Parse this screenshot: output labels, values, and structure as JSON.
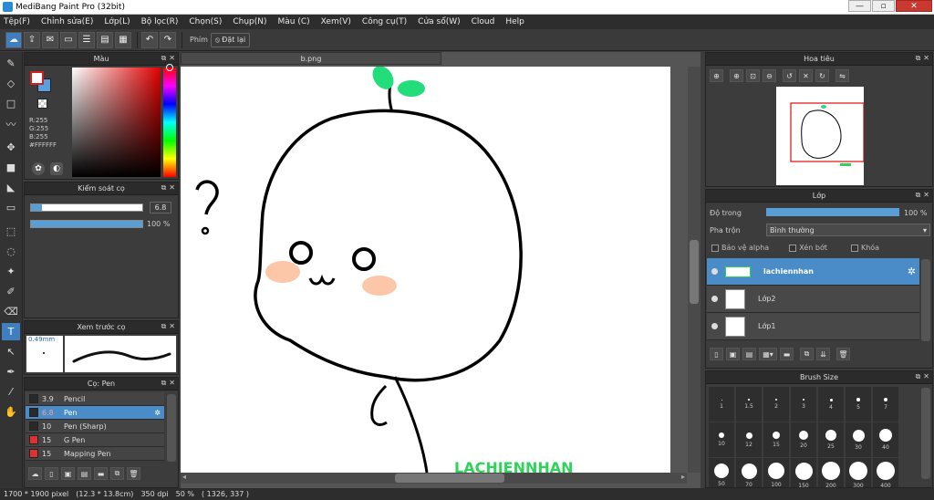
{
  "window": {
    "title": "MediBang Paint Pro (32bit)",
    "minimize": "—",
    "maximize": "▫",
    "close": "✕"
  },
  "menu": [
    "Tệp(F)",
    "Chỉnh sửa(E)",
    "Lớp(L)",
    "Bộ lọc(R)",
    "Chọn(S)",
    "Chụp(N)",
    "Màu (C)",
    "Xem(V)",
    "Công cụ(T)",
    "Cửa sổ(W)",
    "Cloud",
    "Help"
  ],
  "toolbar": {
    "phim_label": "Phím",
    "reset_label": "Đặt lại"
  },
  "color_panel": {
    "title": "Màu",
    "r": "R:255",
    "g": "G:255",
    "b": "B:255",
    "hex": "#FFFFFF"
  },
  "brush_control": {
    "title": "Kiểm soát cọ",
    "size_value": "6.8",
    "size_fraction": 0.07,
    "opacity_value": "100 %",
    "opacity_fraction": 1.0
  },
  "brush_preview": {
    "title": "Xem trước cọ",
    "size": "0.49mm"
  },
  "brush_list": {
    "title": "Cọ: Pen",
    "items": [
      {
        "size": "3.9",
        "name": "Pencil",
        "color": "#2a2a2a"
      },
      {
        "size": "6.8",
        "name": "Pen",
        "color": "#2a2a2a"
      },
      {
        "size": "10",
        "name": "Pen (Sharp)",
        "color": "#2a2a2a"
      },
      {
        "size": "15",
        "name": "G Pen",
        "color": "#e03030"
      },
      {
        "size": "15",
        "name": "Mapping Pen",
        "color": "#e03030"
      }
    ]
  },
  "document": {
    "tab": "b.png",
    "handwriting": "LACHIENNHAN"
  },
  "navigator": {
    "title": "Hoa tiêu"
  },
  "layer_panel": {
    "title": "Lớp",
    "opacity_label": "Độ trong",
    "opacity_value": "100 %",
    "opacity_fraction": 1.0,
    "blend_label": "Pha trộn",
    "blend_value": "Bình thường",
    "protect_alpha": "Bảo vệ alpha",
    "clipping": "Xén bớt",
    "lock": "Khóa",
    "layers": [
      {
        "name": "lachiennhan"
      },
      {
        "name": "Lớp2"
      },
      {
        "name": "Lớp1"
      }
    ]
  },
  "brush_size": {
    "title": "Brush Size",
    "sizes": [
      "1",
      "1.5",
      "2",
      "3",
      "4",
      "5",
      "7",
      "10",
      "12",
      "15",
      "20",
      "25",
      "30",
      "40",
      "50",
      "70",
      "100",
      "150",
      "200",
      "300",
      "400"
    ]
  },
  "status": {
    "dimensions": "1700 * 1900 pixel",
    "physical": "(12.3 * 13.8cm)",
    "dpi": "350 dpi",
    "zoom": "50 %",
    "cursor": "( 1326, 337 )"
  }
}
